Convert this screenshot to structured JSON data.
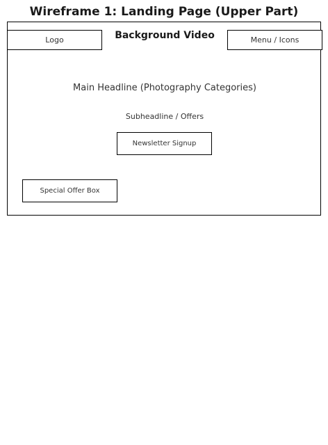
{
  "title": "Wireframe 1: Landing Page (Upper Part)",
  "frame": {
    "label": "Background Video",
    "logo": "Logo",
    "menu": "Menu / Icons",
    "headline": "Main Headline (Photography Categories)",
    "subheadline": "Subheadline / Offers",
    "newsletter": "Newsletter Signup",
    "special_offer": "Special Offer Box"
  },
  "colors": {
    "border": "#000000",
    "text": "#333333",
    "title": "#1a1a1a",
    "background": "#ffffff"
  }
}
